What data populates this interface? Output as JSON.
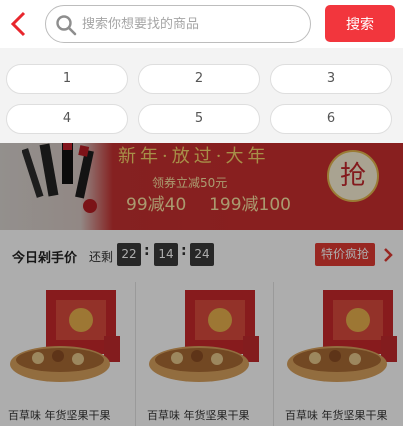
{
  "header": {
    "back_icon": "chevron-left-icon",
    "search_icon": "search-icon",
    "search_placeholder": "搜索你想要找的商品",
    "search_value": "",
    "search_button": "搜索",
    "accent_color": "#f2363d"
  },
  "suggestions": [
    "1",
    "2",
    "3",
    "4",
    "5",
    "6"
  ],
  "banner": {
    "headline": "新年·放过·大年",
    "coupon": "领券立减50元",
    "offer_1": "99减40",
    "offer_2": "199减100",
    "grab": "抢"
  },
  "flash_sale": {
    "title": "今日剁手价",
    "remaining_label": "还剩",
    "hours": "22",
    "minutes": "14",
    "seconds": "24",
    "more_button": "特价疯抢",
    "more_icon": "chevron-right-icon"
  },
  "products": [
    {
      "name": "百草味 年货坚果干果"
    },
    {
      "name": "百草味 年货坚果干果"
    },
    {
      "name": "百草味 年货坚果干果"
    }
  ]
}
